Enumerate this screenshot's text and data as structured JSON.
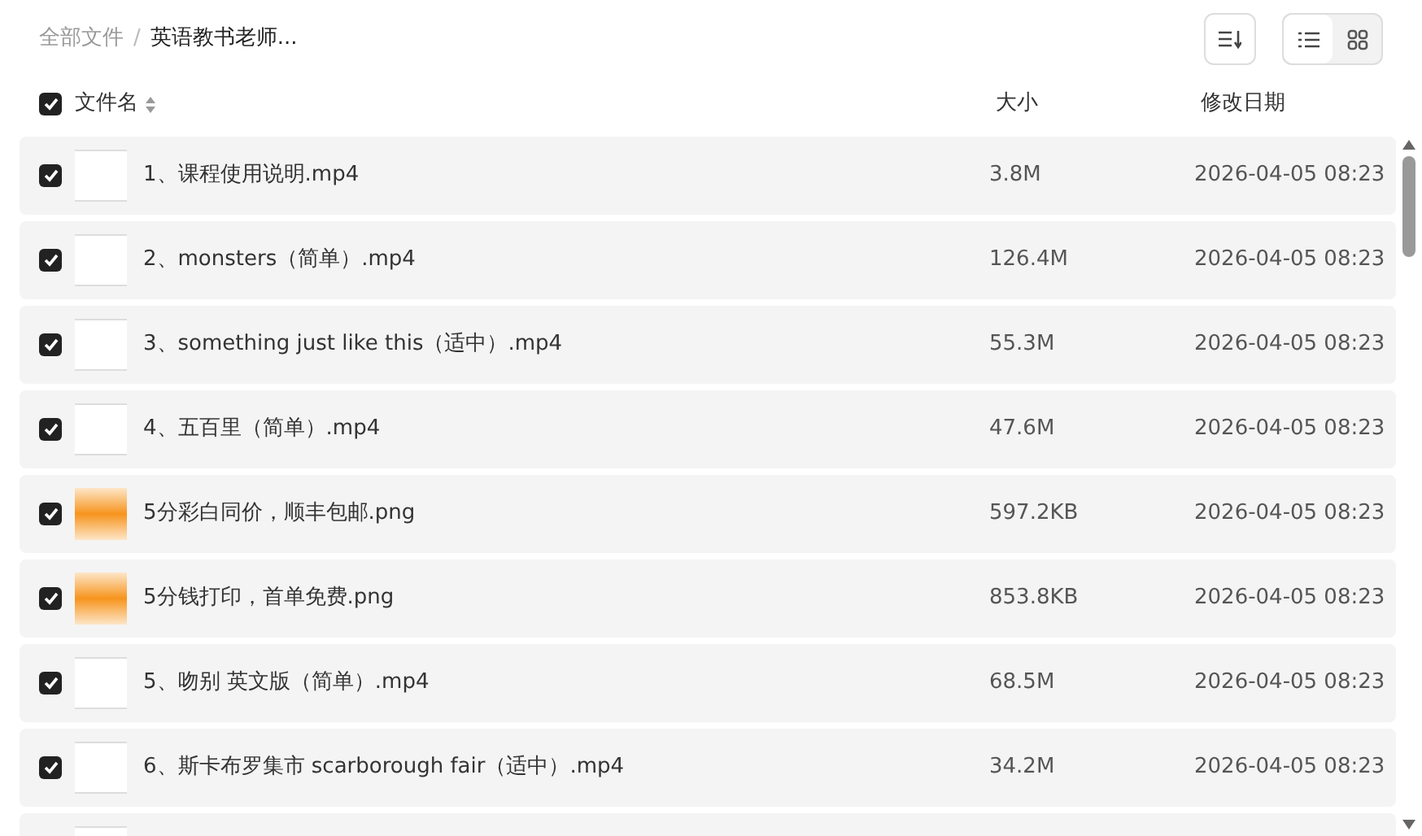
{
  "breadcrumb": [
    {
      "label": "全部文件",
      "current": false
    },
    {
      "label": "英语教书老师...",
      "current": true
    }
  ],
  "breadcrumb_separator": "/",
  "view_toggle": [
    {
      "kind": "list",
      "selected": true
    },
    {
      "kind": "grid",
      "selected": false
    }
  ],
  "header": {
    "checked": true,
    "name": "文件名",
    "size": "大小",
    "date": "修改日期"
  },
  "files": [
    {
      "kind": "video",
      "checked": true,
      "name": "1、课程使用说明.mp4",
      "size": "3.8M",
      "date": "2026-04-05 08:23"
    },
    {
      "kind": "video",
      "checked": true,
      "name": "2、monsters（简单）.mp4",
      "size": "126.4M",
      "date": "2026-04-05 08:23"
    },
    {
      "kind": "video",
      "checked": true,
      "name": "3、something just like this（适中）.mp4",
      "size": "55.3M",
      "date": "2026-04-05 08:23"
    },
    {
      "kind": "video",
      "checked": true,
      "name": "4、五百里（简单）.mp4",
      "size": "47.6M",
      "date": "2026-04-05 08:23"
    },
    {
      "kind": "image",
      "checked": true,
      "name": "5分彩白同价，顺丰包邮.png",
      "size": "597.2KB",
      "date": "2026-04-05 08:23"
    },
    {
      "kind": "image",
      "checked": true,
      "name": "5分钱打印，首单免费.png",
      "size": "853.8KB",
      "date": "2026-04-05 08:23"
    },
    {
      "kind": "video",
      "checked": true,
      "name": "5、吻别 英文版（简单）.mp4",
      "size": "68.5M",
      "date": "2026-04-05 08:23"
    },
    {
      "kind": "video",
      "checked": true,
      "name": "6、斯卡布罗集市 scarborough fair（适中）.mp4",
      "size": "34.2M",
      "date": "2026-04-05 08:23"
    },
    {
      "kind": "video"
    }
  ]
}
